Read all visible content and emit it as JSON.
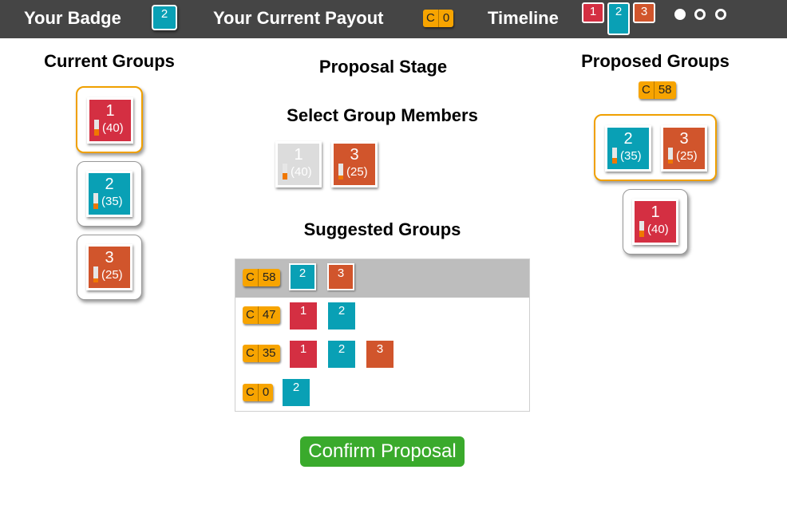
{
  "header": {
    "badge_label": "Your Badge",
    "badge_value": "2",
    "payout_label": "Your Current Payout",
    "payout_letter": "C",
    "payout_value": "0",
    "timeline_label": "Timeline",
    "timeline_items": [
      "1",
      "2",
      "3"
    ],
    "timeline_active": "2",
    "stages": [
      "completed",
      "pending",
      "pending"
    ]
  },
  "stage_title": "Proposal Stage",
  "current_groups": {
    "title": "Current Groups",
    "groups": [
      {
        "selected": true,
        "members": [
          {
            "id": "1",
            "value": "(40)",
            "color": "red",
            "fill": 0.4
          }
        ]
      },
      {
        "selected": false,
        "members": [
          {
            "id": "2",
            "value": "(35)",
            "color": "teal",
            "fill": 0.35
          }
        ]
      },
      {
        "selected": false,
        "members": [
          {
            "id": "3",
            "value": "(25)",
            "color": "orange",
            "fill": 0.25
          }
        ]
      }
    ]
  },
  "select_members": {
    "title": "Select Group Members",
    "members": [
      {
        "id": "1",
        "value": "(40)",
        "color": "gray",
        "fill": 0.4,
        "disabled": true
      },
      {
        "id": "3",
        "value": "(25)",
        "color": "orange",
        "fill": 0.25,
        "disabled": false
      }
    ]
  },
  "suggested_groups": {
    "title": "Suggested Groups",
    "coin_letter": "C",
    "rows": [
      {
        "payout": "58",
        "members": [
          "2",
          "3"
        ],
        "highlighted": true
      },
      {
        "payout": "47",
        "members": [
          "1",
          "2"
        ],
        "highlighted": false
      },
      {
        "payout": "35",
        "members": [
          "1",
          "2",
          "3"
        ],
        "highlighted": false
      },
      {
        "payout": "0",
        "members": [
          "2"
        ],
        "highlighted": false
      }
    ]
  },
  "proposed_groups": {
    "title": "Proposed Groups",
    "coin_letter": "C",
    "payout": "58",
    "groups": [
      {
        "selected": true,
        "members": [
          {
            "id": "2",
            "value": "(35)",
            "color": "teal",
            "fill": 0.35
          },
          {
            "id": "3",
            "value": "(25)",
            "color": "orange",
            "fill": 0.25
          }
        ]
      },
      {
        "selected": false,
        "members": [
          {
            "id": "1",
            "value": "(40)",
            "color": "red",
            "fill": 0.4
          }
        ]
      }
    ]
  },
  "confirm_label": "Confirm Proposal",
  "colors": {
    "red": "#d42f42",
    "teal": "#09a0b5",
    "orange": "#d1552c",
    "coin": "#f7a400",
    "confirm": "#3aaa2c",
    "bar_fill": "#f07800"
  }
}
